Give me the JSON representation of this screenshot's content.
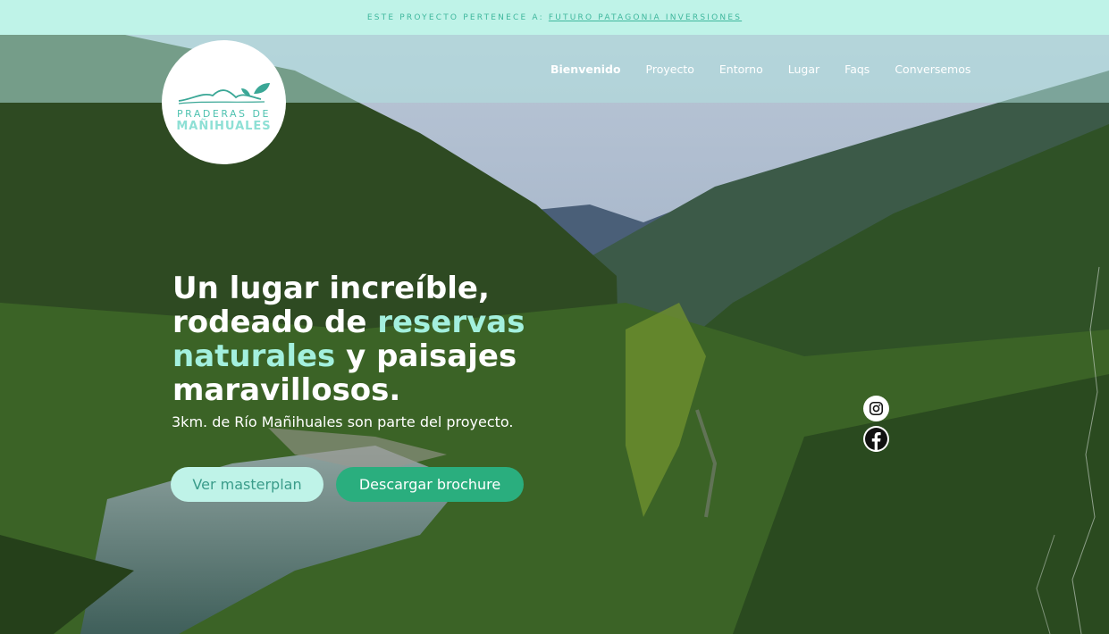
{
  "topbar": {
    "prefix": "ESTE PROYECTO PERTENECE A:",
    "link": "FUTURO PATAGONIA INVERSIONES"
  },
  "logo": {
    "line1": "PRADERAS DE",
    "line2": "MAÑIHUALES"
  },
  "nav": {
    "items": [
      "Bienvenido",
      "Proyecto",
      "Entorno",
      "Lugar",
      "Faqs",
      "Conversemos"
    ],
    "active": "Bienvenido"
  },
  "hero": {
    "headline_1": "Un lugar increíble,",
    "headline_2a": "rodeado de ",
    "headline_2b": "reservas",
    "headline_3a": "naturales",
    "headline_3b": " y paisajes",
    "headline_4": "maravillosos.",
    "subtitle": "3km. de Río Mañihuales son parte del proyecto."
  },
  "buttons": {
    "masterplan": "Ver masterplan",
    "brochure": "Descargar brochure"
  },
  "social": [
    "instagram-icon",
    "facebook-icon"
  ],
  "colors": {
    "topbar_bg": "#bff3e8",
    "accent": "#2aae7e",
    "highlight_text": "#a3f0de"
  }
}
